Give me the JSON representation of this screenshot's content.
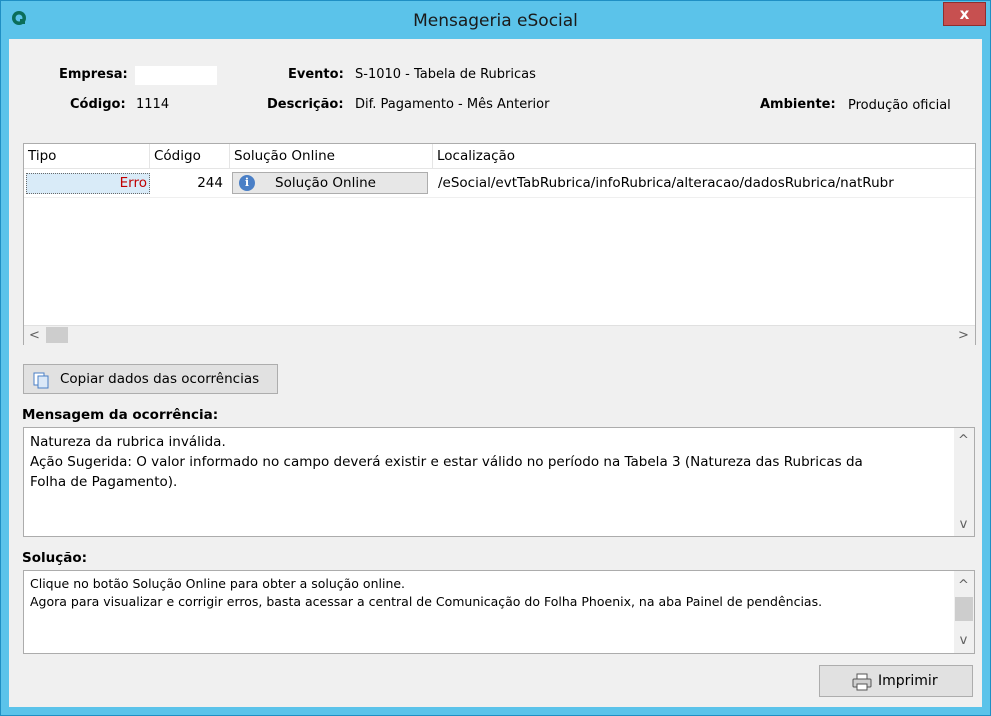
{
  "window": {
    "title": "Mensageria eSocial",
    "close_label": "x"
  },
  "header": {
    "empresa_label": "Empresa:",
    "empresa_value": "",
    "codigo_label": "Código:",
    "codigo_value": "1114",
    "evento_label": "Evento:",
    "evento_value": "S-1010 - Tabela de Rubricas",
    "descricao_label": "Descrição:",
    "descricao_value": "Dif. Pagamento - Mês Anterior",
    "ambiente_label": "Ambiente:",
    "ambiente_value": "Produção oficial"
  },
  "grid": {
    "columns": [
      "Tipo",
      "Código",
      "Solução Online",
      "Localização"
    ],
    "rows": [
      {
        "tipo": "Erro",
        "codigo": "244",
        "solucao": "Solução Online",
        "localizacao": "/eSocial/evtTabRubrica/infoRubrica/alteracao/dadosRubrica/natRubr"
      }
    ],
    "scroll_left": "<",
    "scroll_right": ">"
  },
  "copy_button": {
    "label": "Copiar dados das ocorrências"
  },
  "mensagem": {
    "label": "Mensagem da ocorrência:",
    "lines": [
      "Natureza da rubrica inválida.",
      "Ação Sugerida: O valor informado no campo deverá existir e estar válido no período na Tabela 3 (Natureza das Rubricas da",
      "Folha de Pagamento)."
    ]
  },
  "solucao": {
    "label": "Solução:",
    "lines": [
      "Clique no botão Solução Online para obter a solução online.",
      "Agora para visualizar e corrigir erros, basta acessar a central de Comunicação do Folha Phoenix, na aba Painel de pendências."
    ]
  },
  "scroll_up": "^",
  "scroll_down": "v",
  "print_button": {
    "label": "Imprimir"
  },
  "colors": {
    "titlebar": "#5bc3ea",
    "error_text": "#c00000",
    "close_button": "#c75050"
  },
  "icons": {
    "app": "app-logo-icon",
    "info": "info-icon",
    "copy": "copy-icon",
    "print": "printer-icon"
  }
}
